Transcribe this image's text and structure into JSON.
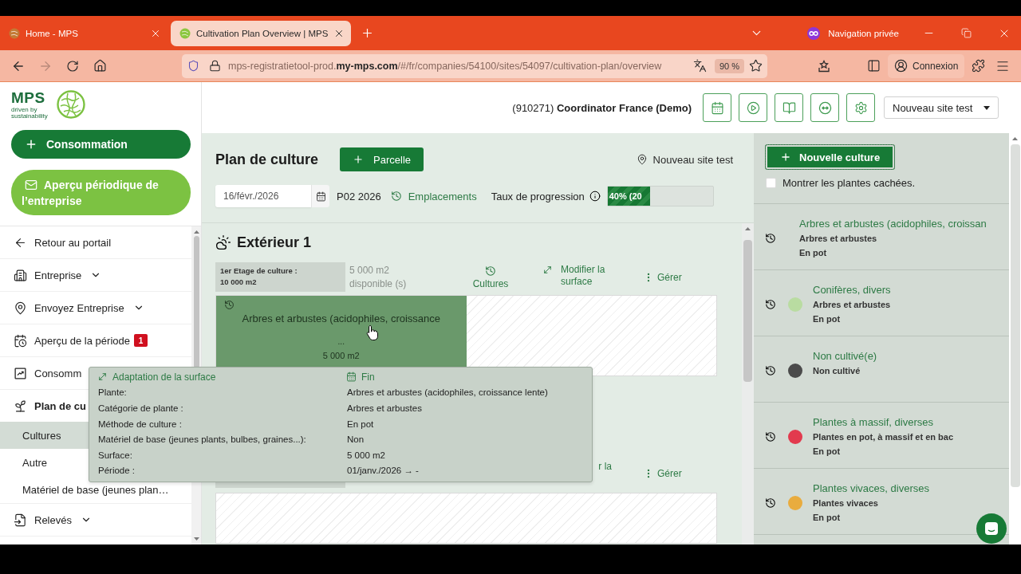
{
  "browser": {
    "tabs": [
      {
        "title": "Home - MPS",
        "selected": false
      },
      {
        "title": "Cultivation Plan Overview | MPS",
        "selected": true
      }
    ],
    "private_mode": "Navigation privée",
    "address": "mps-registratietool-prod.**my-mps.com**/#/fr/companies/54100/sites/54097/cultivation-plan/overview",
    "zoom": "90 %",
    "account": "Connexion"
  },
  "sidebar": {
    "logo": "MPS",
    "tagline": "driven by sustainability",
    "actions": [
      {
        "kind": "primary",
        "label": "Consommation"
      },
      {
        "kind": "secondary",
        "label": "Aperçu périodique de l’entreprise"
      }
    ],
    "menu": [
      {
        "label": "Retour au portail",
        "selected": false
      },
      {
        "label": "Entreprise",
        "selected": false,
        "expanded": false
      },
      {
        "label": "Envoyez Entreprise",
        "selected": false,
        "expanded": false
      },
      {
        "label": "Aperçu de la période",
        "selected": false,
        "badge": "1"
      },
      {
        "label": "Consomm",
        "selected": false
      },
      {
        "label": "Plan de cu",
        "selected": true,
        "children": [
          {
            "label": "Cultures",
            "selected": true
          },
          {
            "label": "Autre",
            "selected": false
          },
          {
            "label": "Matériel de base (jeunes plan…",
            "selected": false
          }
        ]
      },
      {
        "label": "Relevés",
        "selected": false,
        "expanded": false
      }
    ]
  },
  "header": {
    "account": "(910271) **Coordinator France (Demo)**",
    "site_select": "Nouveau site test"
  },
  "plan": {
    "title": "Plan de culture",
    "add_button": "Parcelle",
    "site": "Nouveau site test",
    "date": "16/févr./2026",
    "period": "P02 2026",
    "locations_link": "Emplacements",
    "progress": {
      "label": "Taux de progression",
      "level": 0.4,
      "reading": "40% (20"
    },
    "sections": [
      {
        "title": "Extérieur 1",
        "parcels": [
          {
            "floor": {
              "label": "1er Etage de culture :",
              "area": "10 000 m2"
            },
            "available": {
              "area": "5 000 m2",
              "label": "disponible (s)"
            },
            "actions": [
              {
                "kind": "history",
                "label": "Cultures"
              },
              {
                "kind": "resize",
                "label": "Modifier la surface"
              },
              {
                "kind": "manage",
                "label": "Gérer"
              }
            ],
            "crops": [
              {
                "name": "Arbres et arbustes (acidophiles, croissance",
                "more": "...",
                "area": "5 000 m2",
                "level": 0.5
              }
            ]
          },
          {
            "actions": [
              {
                "kind": "fragment",
                "label": "r la"
              },
              {
                "kind": "manage",
                "label": "Gérer"
              }
            ]
          }
        ]
      }
    ]
  },
  "tooltip": {
    "actions": [
      {
        "kind": "resize",
        "label": "Adaptation de la surface"
      },
      {
        "kind": "end",
        "label": "Fin"
      }
    ],
    "rows": [
      {
        "label": "Plante:",
        "value": "Arbres et arbustes (acidophiles, croissance lente)"
      },
      {
        "label": "Catégorie de plante :",
        "value": "Arbres et arbustes"
      },
      {
        "label": "Méthode de culture :",
        "value": "En pot"
      },
      {
        "label": "Matériel de base (jeunes plants, bulbes, graines...):",
        "value": "Non"
      },
      {
        "label": "Surface:",
        "value": "5 000 m2"
      },
      {
        "label": "Période :",
        "value": "01/janv./2026 → -"
      }
    ]
  },
  "crop_panel": {
    "new_button": "Nouvelle culture",
    "show_hidden": {
      "label": "Montrer les plantes cachées.",
      "checked": false
    },
    "crops": [
      {
        "name": "Arbres et arbustes (acidophiles, croissan",
        "category": "Arbres et arbustes",
        "method": "En pot"
      },
      {
        "name": "Conifères, divers",
        "color": "#b9dca1",
        "category": "Arbres et arbustes",
        "method": "En pot"
      },
      {
        "name": "Non cultivé(e)",
        "color": "#4b4b4b",
        "category": "Non cultivé"
      },
      {
        "name": "Plantes à massif, diverses",
        "color": "#e23a4e",
        "category": "Plantes en pot, à massif et en bac",
        "method": "En pot"
      },
      {
        "name": "Plantes vivaces, diverses",
        "color": "#e9ac3e",
        "category": "Plantes vivaces",
        "method": "En pot"
      }
    ]
  }
}
